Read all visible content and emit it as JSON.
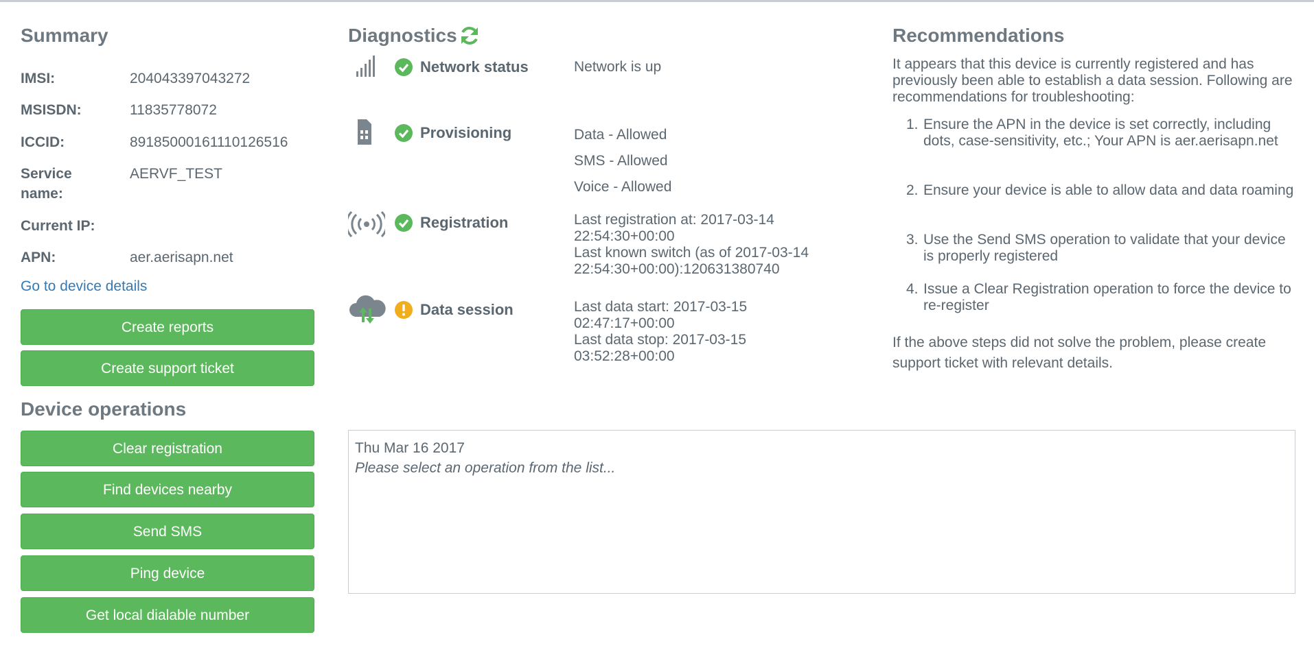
{
  "summary": {
    "title": "Summary",
    "rows": [
      {
        "label": "IMSI:",
        "value": "204043397043272"
      },
      {
        "label": "MSISDN:",
        "value": "11835778072"
      },
      {
        "label": "ICCID:",
        "value": "89185000161110126516"
      },
      {
        "label": "Service name:",
        "value": "AERVF_TEST"
      },
      {
        "label": "Current IP:",
        "value": ""
      },
      {
        "label": "APN:",
        "value": "aer.aerisapn.net"
      }
    ],
    "details_link": "Go to device details",
    "buttons": [
      "Create reports",
      "Create support ticket"
    ]
  },
  "device_operations": {
    "title": "Device operations",
    "buttons": [
      "Clear registration",
      "Find devices nearby",
      "Send SMS",
      "Ping device",
      "Get local dialable number"
    ]
  },
  "diagnostics": {
    "title": "Diagnostics",
    "items": [
      {
        "label": "Network status",
        "icon": "signal-bars-icon",
        "status": "ok",
        "lines": [
          "Network is up"
        ]
      },
      {
        "label": "Provisioning",
        "icon": "sim-card-icon",
        "status": "ok",
        "lines": [
          "Data - Allowed",
          "SMS - Allowed",
          "Voice - Allowed"
        ]
      },
      {
        "label": "Registration",
        "icon": "broadcast-icon",
        "status": "ok",
        "lines": [
          "Last registration at: 2017-03-14",
          "22:54:30+00:00",
          "Last known switch (as of 2017-03-14",
          "22:54:30+00:00):120631380740"
        ]
      },
      {
        "label": "Data session",
        "icon": "cloud-transfer-icon",
        "status": "warning",
        "lines": [
          "Last data start: 2017-03-15",
          "02:47:17+00:00",
          "Last data stop: 2017-03-15",
          "03:52:28+00:00"
        ]
      }
    ],
    "colors": {
      "ok": "#5cb85c",
      "warning": "#f0ad1e",
      "icon": "#7a858d"
    }
  },
  "recommendations": {
    "title": "Recommendations",
    "intro": "It appears that this device is currently registered and has previously been able to establish a data session. Following are recommendations for troubleshooting:",
    "items": [
      {
        "num": "1.",
        "text": "Ensure the APN in the device is set correctly, including dots, case-sensitivity, etc.; Your APN is aer.aerisapn.net"
      },
      {
        "num": "2.",
        "text": "Ensure your device is able to allow data and data roaming"
      },
      {
        "num": "3.",
        "text": "Use the Send SMS operation to validate that your device is properly registered"
      },
      {
        "num": "4.",
        "text": "Issue a Clear Registration operation to force the device to re-register"
      }
    ],
    "footer": "If the above steps did not solve the problem, please create support ticket with relevant details."
  },
  "output": {
    "date": "Thu Mar 16 2017",
    "placeholder": "Please select an operation from the list..."
  }
}
